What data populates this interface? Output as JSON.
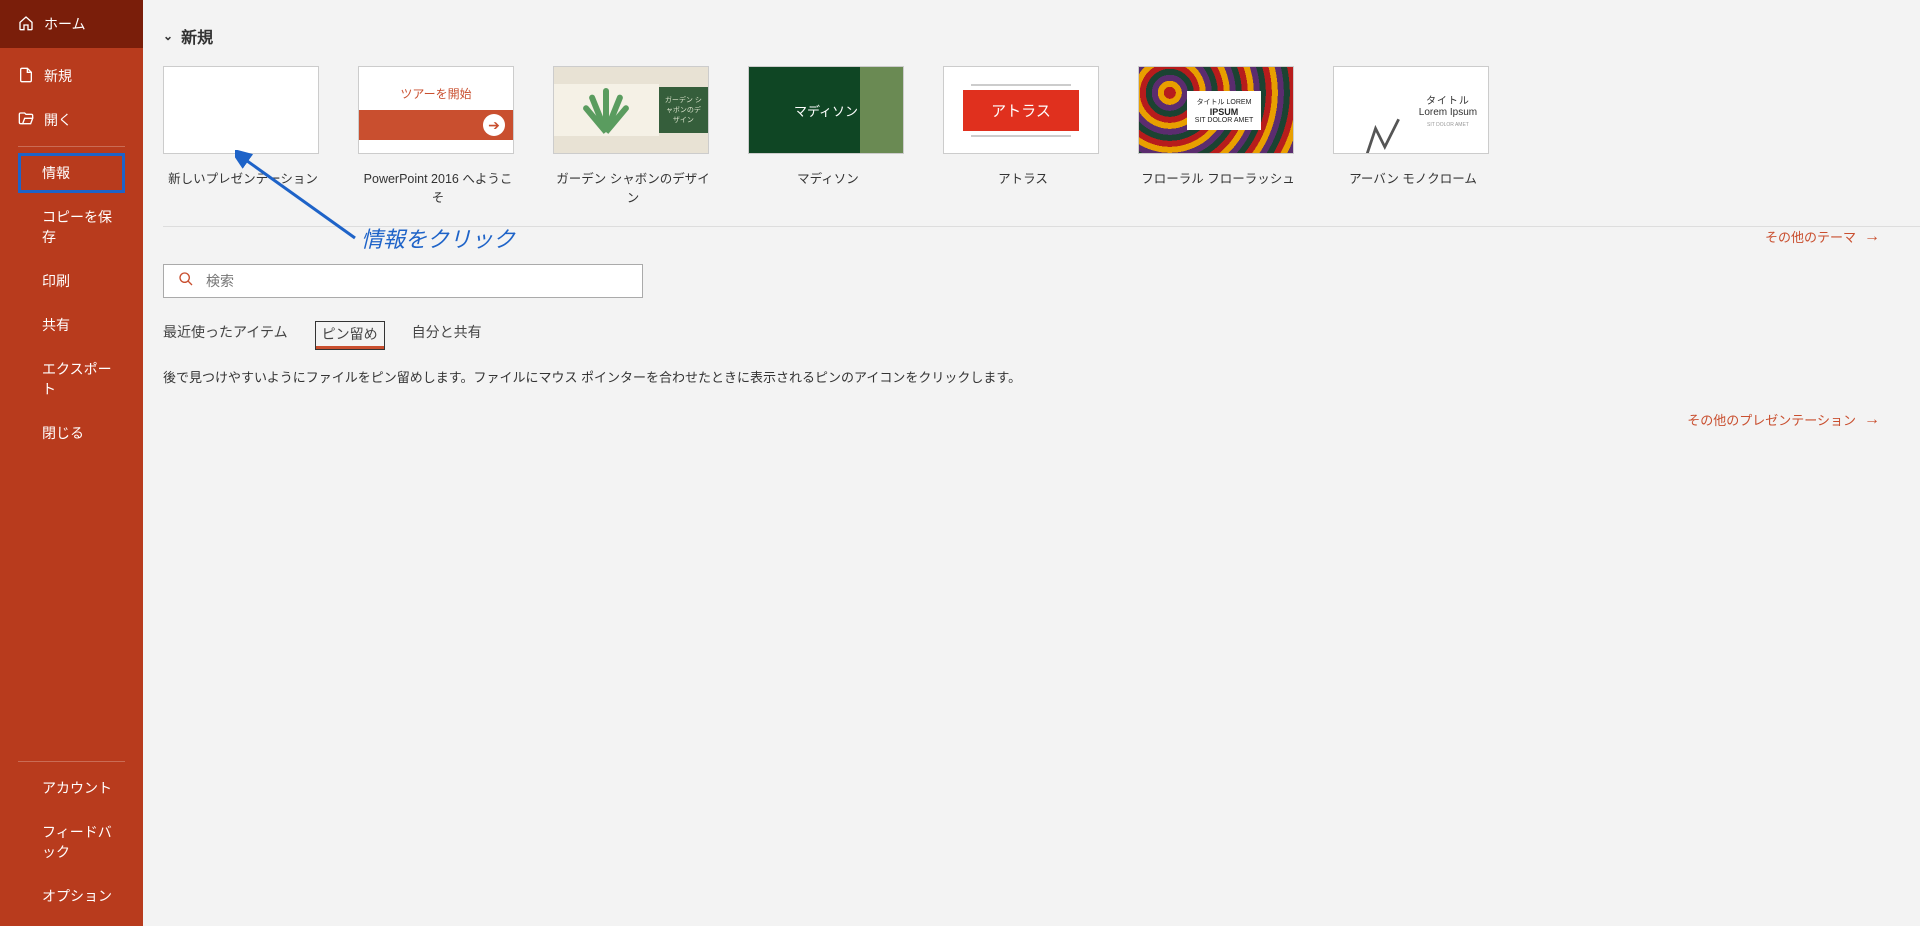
{
  "sidebar": {
    "home": "ホーム",
    "new": "新規",
    "open": "開く",
    "info": "情報",
    "save_copy": "コピーを保存",
    "print": "印刷",
    "share": "共有",
    "export": "エクスポート",
    "close": "閉じる",
    "account": "アカウント",
    "feedback": "フィードバック",
    "options": "オプション"
  },
  "section_title": "新規",
  "templates": [
    {
      "label": "新しいプレゼンテーション"
    },
    {
      "label": "PowerPoint 2016 へようこそ",
      "tour_text": "ツアーを開始"
    },
    {
      "label": "ガーデン シャボンのデザイン",
      "side_text": "ガーデン シャボンのデザイン"
    },
    {
      "label": "マディソン",
      "center_text": "マディソン"
    },
    {
      "label": "アトラス",
      "center_text": "アトラス"
    },
    {
      "label": "フローラル フローラッシュ",
      "card_top": "タイトル LOREM",
      "card_mid": "IPSUM",
      "card_bot": "SIT DOLOR AMET"
    },
    {
      "label": "アーバン モノクローム",
      "t1": "タイトル",
      "t2": "Lorem Ipsum",
      "t3": "SIT DOLOR AMET"
    }
  ],
  "annotation": "情報をクリック",
  "more_themes": "その他のテーマ",
  "search": {
    "placeholder": "検索"
  },
  "tabs": {
    "recent": "最近使ったアイテム",
    "pinned": "ピン留め",
    "shared": "自分と共有"
  },
  "hint": "後で見つけやすいようにファイルをピン留めします。ファイルにマウス ポインターを合わせたときに表示されるピンのアイコンをクリックします。",
  "more_presentations": "その他のプレゼンテーション"
}
